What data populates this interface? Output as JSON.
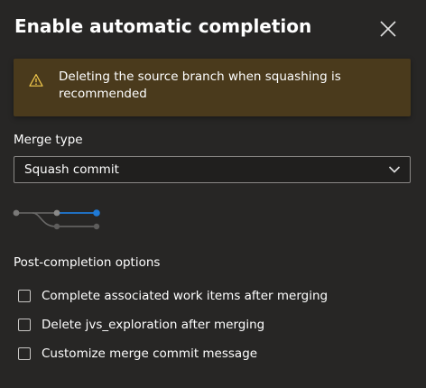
{
  "dialog": {
    "title": "Enable automatic completion",
    "close_icon": "close-icon"
  },
  "warning": {
    "icon": "warning-icon",
    "text": "Deleting the source branch when squashing is recommended",
    "color": "#4a3a1c",
    "icon_color": "#f2c94c"
  },
  "merge": {
    "label": "Merge type",
    "selected": "Squash commit",
    "diagram_icon": "squash-commit-diagram-icon",
    "accent": "#1f7ad6"
  },
  "post_completion": {
    "label": "Post-completion options",
    "options": [
      {
        "label": "Complete associated work items after merging",
        "checked": false
      },
      {
        "label": "Delete jvs_exploration after merging",
        "checked": false
      },
      {
        "label": "Customize merge commit message",
        "checked": false
      }
    ]
  }
}
